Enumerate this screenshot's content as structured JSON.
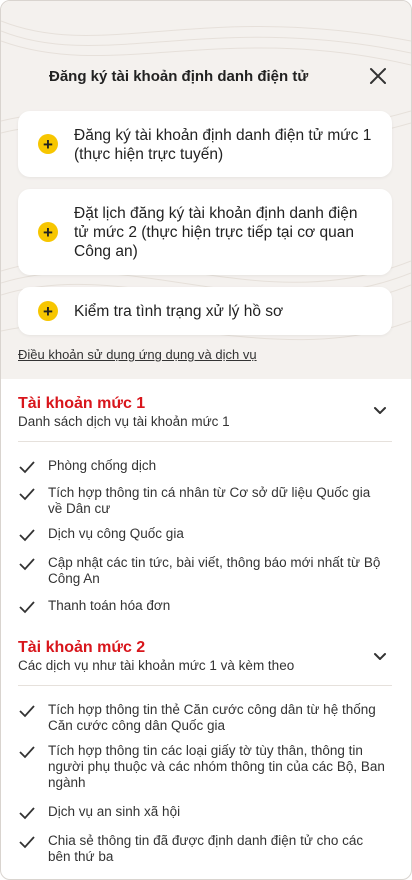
{
  "header": {
    "title": "Đăng ký tài khoản định danh điện tử"
  },
  "cards": [
    {
      "label": "Đăng ký tài khoản định danh điện tử mức 1 (thực hiện trực tuyến)"
    },
    {
      "label": "Đặt lịch đăng ký tài khoản định danh điện tử mức 2 (thực hiện trực tiếp tại cơ quan Công an)"
    },
    {
      "label": "Kiểm tra tình trạng xử lý hồ sơ"
    }
  ],
  "terms_link": "Điều khoản sử dụng ứng dụng và dịch vụ",
  "level1": {
    "title": "Tài khoản mức 1",
    "subtitle": "Danh sách dịch vụ tài khoản mức 1",
    "items": [
      "Phòng chống dịch",
      "Tích hợp thông tin cá nhân từ Cơ sở dữ liệu Quốc gia về Dân cư",
      "Dịch vụ công Quốc gia",
      "Cập nhật các tin tức, bài viết, thông báo mới nhất từ Bộ Công An",
      "Thanh toán hóa đơn"
    ]
  },
  "level2": {
    "title": "Tài khoản mức 2",
    "subtitle": "Các dịch vụ như tài khoản mức 1 và kèm theo",
    "items": [
      "Tích hợp thông tin thẻ Căn cước công dân từ hệ thống Căn cước công dân Quốc gia",
      "Tích hợp thông tin các loại giấy tờ tùy thân, thông tin người phụ thuộc và các nhóm thông tin của các Bộ, Ban ngành",
      "Dịch vụ an sinh xã hội",
      "Chia sẻ thông tin đã được định danh điện tử cho các bên thứ ba"
    ]
  },
  "colors": {
    "accent_red": "#d8151b",
    "plus_yellow": "#f7c600",
    "top_background": "#f4f1ee"
  },
  "icons": {
    "close": "close-icon",
    "plus": "plus-icon",
    "chevron": "chevron-down-icon",
    "check": "check-icon"
  }
}
